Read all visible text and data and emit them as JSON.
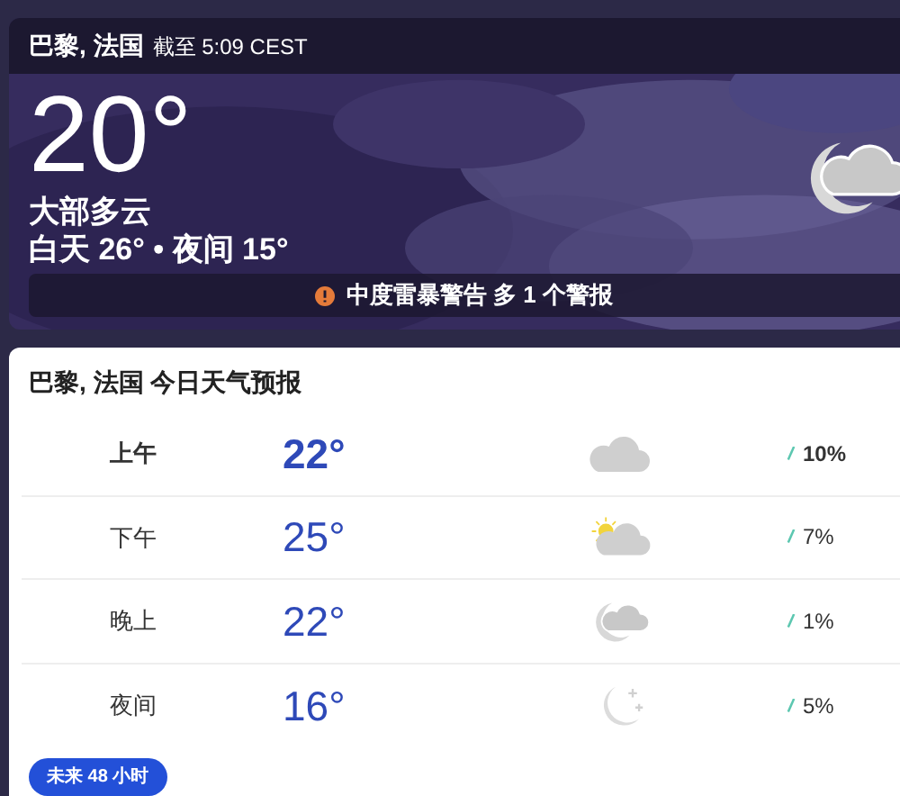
{
  "header": {
    "location": "巴黎, 法国",
    "updated": "截至 5:09 CEST"
  },
  "current": {
    "temperature": "20°",
    "condition": "大部多云",
    "high_low": "白天 26° • 夜间 15°",
    "kind": "cloudy-night"
  },
  "alert": {
    "text": "中度雷暴警告 多 1 个警报"
  },
  "forecast": {
    "title": "巴黎, 法国 今日天气预报",
    "rows": [
      {
        "period": "上午",
        "temperature": "22°",
        "kind": "cloudy",
        "precipitation": "10%",
        "current": true
      },
      {
        "period": "下午",
        "temperature": "25°",
        "kind": "partly-sunny",
        "precipitation": "7%",
        "current": false
      },
      {
        "period": "晚上",
        "temperature": "22°",
        "kind": "cloudy-night",
        "precipitation": "1%",
        "current": false
      },
      {
        "period": "夜间",
        "temperature": "16°",
        "kind": "clear-night",
        "precipitation": "5%",
        "current": false
      }
    ],
    "button": "未来 48 小时"
  }
}
